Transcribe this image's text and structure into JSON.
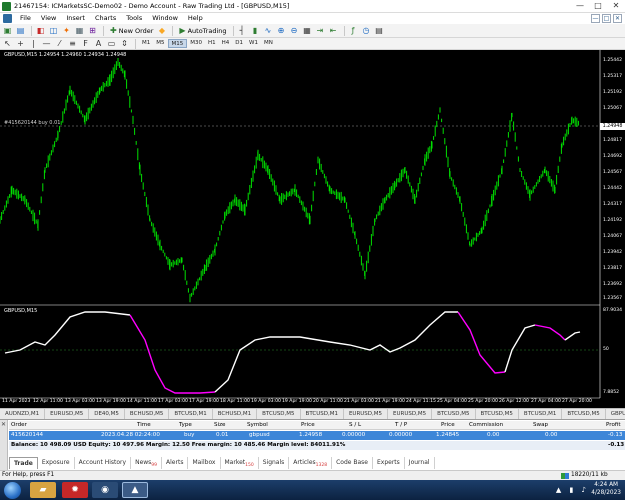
{
  "window": {
    "title": "21467154: ICMarketsSC-Demo02 - Demo Account - Raw Trading Ltd - [GBPUSD,M15]",
    "controls": [
      "—",
      "□",
      "✕"
    ]
  },
  "menu": {
    "items": [
      "File",
      "View",
      "Insert",
      "Charts",
      "Tools",
      "Window",
      "Help"
    ]
  },
  "toolbar": {
    "new_order": "New Order",
    "autotrading": "AutoTrading",
    "timeframes": [
      "M1",
      "M5",
      "M15",
      "M30",
      "H1",
      "H4",
      "D1",
      "W1",
      "MN"
    ],
    "active_timeframe": "M15"
  },
  "chart": {
    "symbol_info": "GBPUSD,M15  1.24954 1.24960 1.24934 1.24948",
    "order_line_label": "#415620144 buy 0.01",
    "indicator_label": "GBPUSD,M15",
    "price_ticks": [
      "1.25442",
      "1.25317",
      "1.25192",
      "1.25067",
      "1.24942",
      "1.24817",
      "1.24692",
      "1.24567",
      "1.24442",
      "1.24317",
      "1.24192",
      "1.24067",
      "1.23942",
      "1.23817",
      "1.23692",
      "1.23567"
    ],
    "current_price": "1.24948",
    "osc_ticks": [
      "87.9034",
      "50",
      "7.8852"
    ],
    "time_ticks": [
      "11 Apr 2023",
      "12 Apr 11:00",
      "13 Apr 03:00",
      "13 Apr 19:00",
      "14 Apr 11:00",
      "17 Apr 03:00",
      "17 Apr 19:00",
      "18 Apr 11:00",
      "19 Apr 03:00",
      "19 Apr 19:00",
      "20 Apr 11:00",
      "21 Apr 03:00",
      "21 Apr 19:00",
      "24 Apr 11:15",
      "25 Apr 04:00",
      "25 Apr 20:00",
      "26 Apr 12:00",
      "27 Apr 04:00",
      "27 Apr 20:00"
    ],
    "colors": {
      "background": "#000000",
      "candles": "#00e000",
      "oscillator_up": "#ffffff",
      "oscillator_down": "#ff00ff",
      "mid_level": "#2a8a2a",
      "order_line": "#9a9a9a"
    }
  },
  "chart_tabs": [
    "AUDNZD,M1",
    "EURUSD,M5",
    "DE40,M5",
    "BCHUSD,M5",
    "BTCUSD,M1",
    "BCHUSD,M1",
    "BTCUSD,M5",
    "BTCUSD,M1",
    "EURUSD,M5",
    "EURUSD,M5",
    "BTCUSD,M5",
    "BTCUSD,M5",
    "BTCUSD,M1",
    "BTCUSD,M5",
    "GBPUSD,M15",
    "BTCUSD,M1",
    "BTCU"
  ],
  "terminal": {
    "headers": [
      "Order",
      "Time",
      "Type",
      "Size",
      "Symbol",
      "Price",
      "S / L",
      "T / P",
      "Price",
      "Commission",
      "Swap",
      "Profit"
    ],
    "order": {
      "id": "415620144",
      "time": "2023.04.28 02:24:00",
      "type": "buy",
      "size": "0.01",
      "symbol": "gbpusd",
      "price": "1.24958",
      "sl": "0.00000",
      "tp": "0.00000",
      "current_price": "1.24845",
      "commission": "0.00",
      "swap": "0.00",
      "profit": "-0.13"
    },
    "summary": "Balance: 10 498.09 USD  Equity: 10 497.96  Margin: 12.50  Free margin: 10 485.46  Margin level: 84011.91%",
    "summary_profit": "-0.13",
    "tabs": [
      {
        "label": "Trade",
        "badge": ""
      },
      {
        "label": "Exposure",
        "badge": ""
      },
      {
        "label": "Account History",
        "badge": ""
      },
      {
        "label": "News",
        "badge": "99"
      },
      {
        "label": "Alerts",
        "badge": ""
      },
      {
        "label": "Mailbox",
        "badge": ""
      },
      {
        "label": "Market",
        "badge": "150"
      },
      {
        "label": "Signals",
        "badge": ""
      },
      {
        "label": "Articles",
        "badge": "1328"
      },
      {
        "label": "Code Base",
        "badge": ""
      },
      {
        "label": "Experts",
        "badge": ""
      },
      {
        "label": "Journal",
        "badge": ""
      }
    ]
  },
  "status": {
    "help": "For Help, press F1",
    "traffic": "18220/11 kb"
  },
  "taskbar": {
    "time": "4:24 AM",
    "date": "4/28/2023"
  }
}
